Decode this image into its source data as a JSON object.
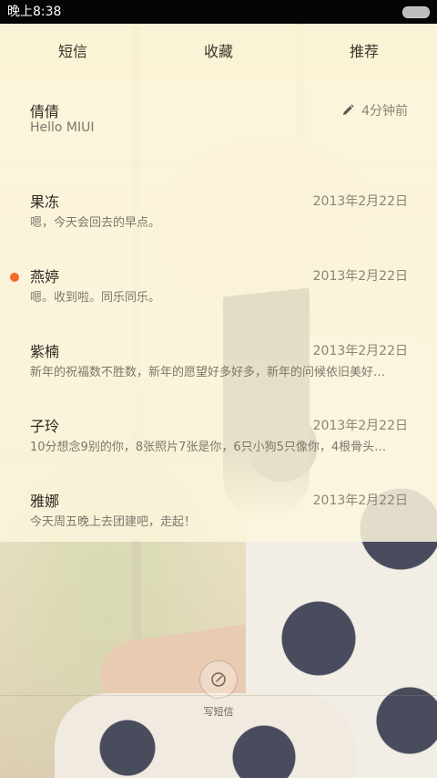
{
  "status_bar": {
    "time": "晚上8:38"
  },
  "tabs": [
    {
      "label": "短信"
    },
    {
      "label": "收藏"
    },
    {
      "label": "推荐"
    }
  ],
  "conversations": [
    {
      "name": "倩倩",
      "preview": "Hello MIUI",
      "time": "4分钟前",
      "draft": true,
      "unread": false
    },
    {
      "name": "果冻",
      "preview": "嗯，今天会回去的早点。",
      "time": "2013年2月22日",
      "unread": false
    },
    {
      "name": "燕婷",
      "preview": "嗯。收到啦。同乐同乐。",
      "time": "2013年2月22日",
      "unread": true
    },
    {
      "name": "紫楠",
      "preview": "新年的祝福数不胜数，新年的愿望好多好多，新年的问候依旧美好…",
      "time": "2013年2月22日",
      "unread": false
    },
    {
      "name": "子玲",
      "preview": "10分想念9别的你，8张照片7张是你，6只小狗5只像你，4根骨头…",
      "time": "2013年2月22日",
      "unread": false
    },
    {
      "name": "雅娜",
      "preview": "今天周五晚上去团建吧，走起！",
      "time": "2013年2月22日",
      "unread": false
    }
  ],
  "compose": {
    "label": "写短信"
  },
  "colors": {
    "accent_unread": "#f56a26",
    "row_bg": "#fcf6dc",
    "status_bg": "#050505"
  },
  "icons": {
    "draft": "pencil-icon",
    "compose": "compose-icon",
    "battery": "battery-icon"
  }
}
